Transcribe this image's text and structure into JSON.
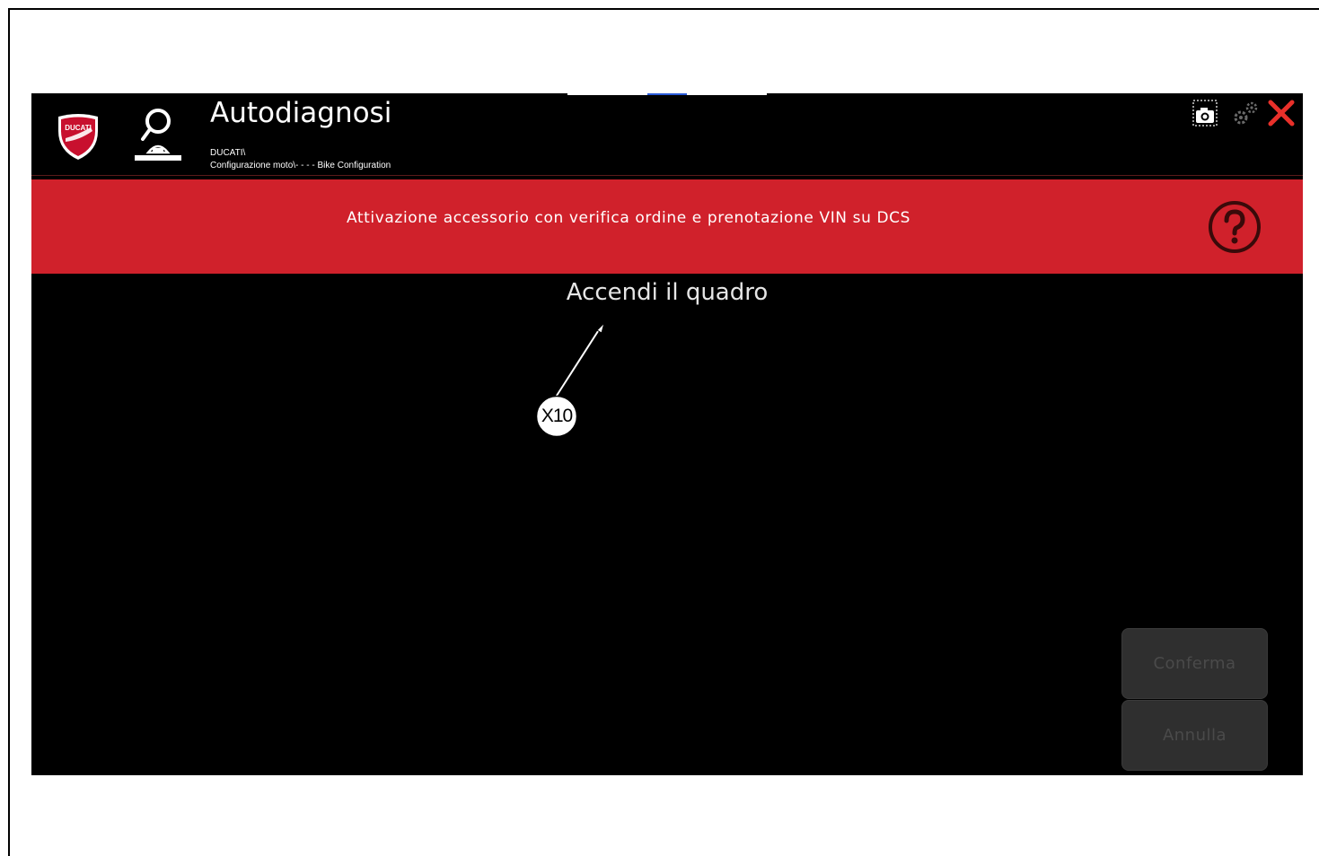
{
  "window": {
    "title": "Autodiagnosi",
    "breadcrumb_line1": "DUCATI\\",
    "breadcrumb_line2": "Configurazione moto\\- - - - Bike Configuration"
  },
  "brand": {
    "logo_text": "DUCATI",
    "accent_color": "#d0212b"
  },
  "toolbar": {
    "icons": [
      "snapshot-icon",
      "settings-icon",
      "close-icon"
    ]
  },
  "banner": {
    "text": "Attivazione accessorio con verifica ordine e prenotazione VIN su DCS",
    "help_icon": "help-icon"
  },
  "main": {
    "instruction": "Accendi il quadro"
  },
  "buttons": {
    "confirm_label": "Conferma",
    "cancel_label": "Annulla"
  },
  "callout": {
    "label": "X10"
  }
}
